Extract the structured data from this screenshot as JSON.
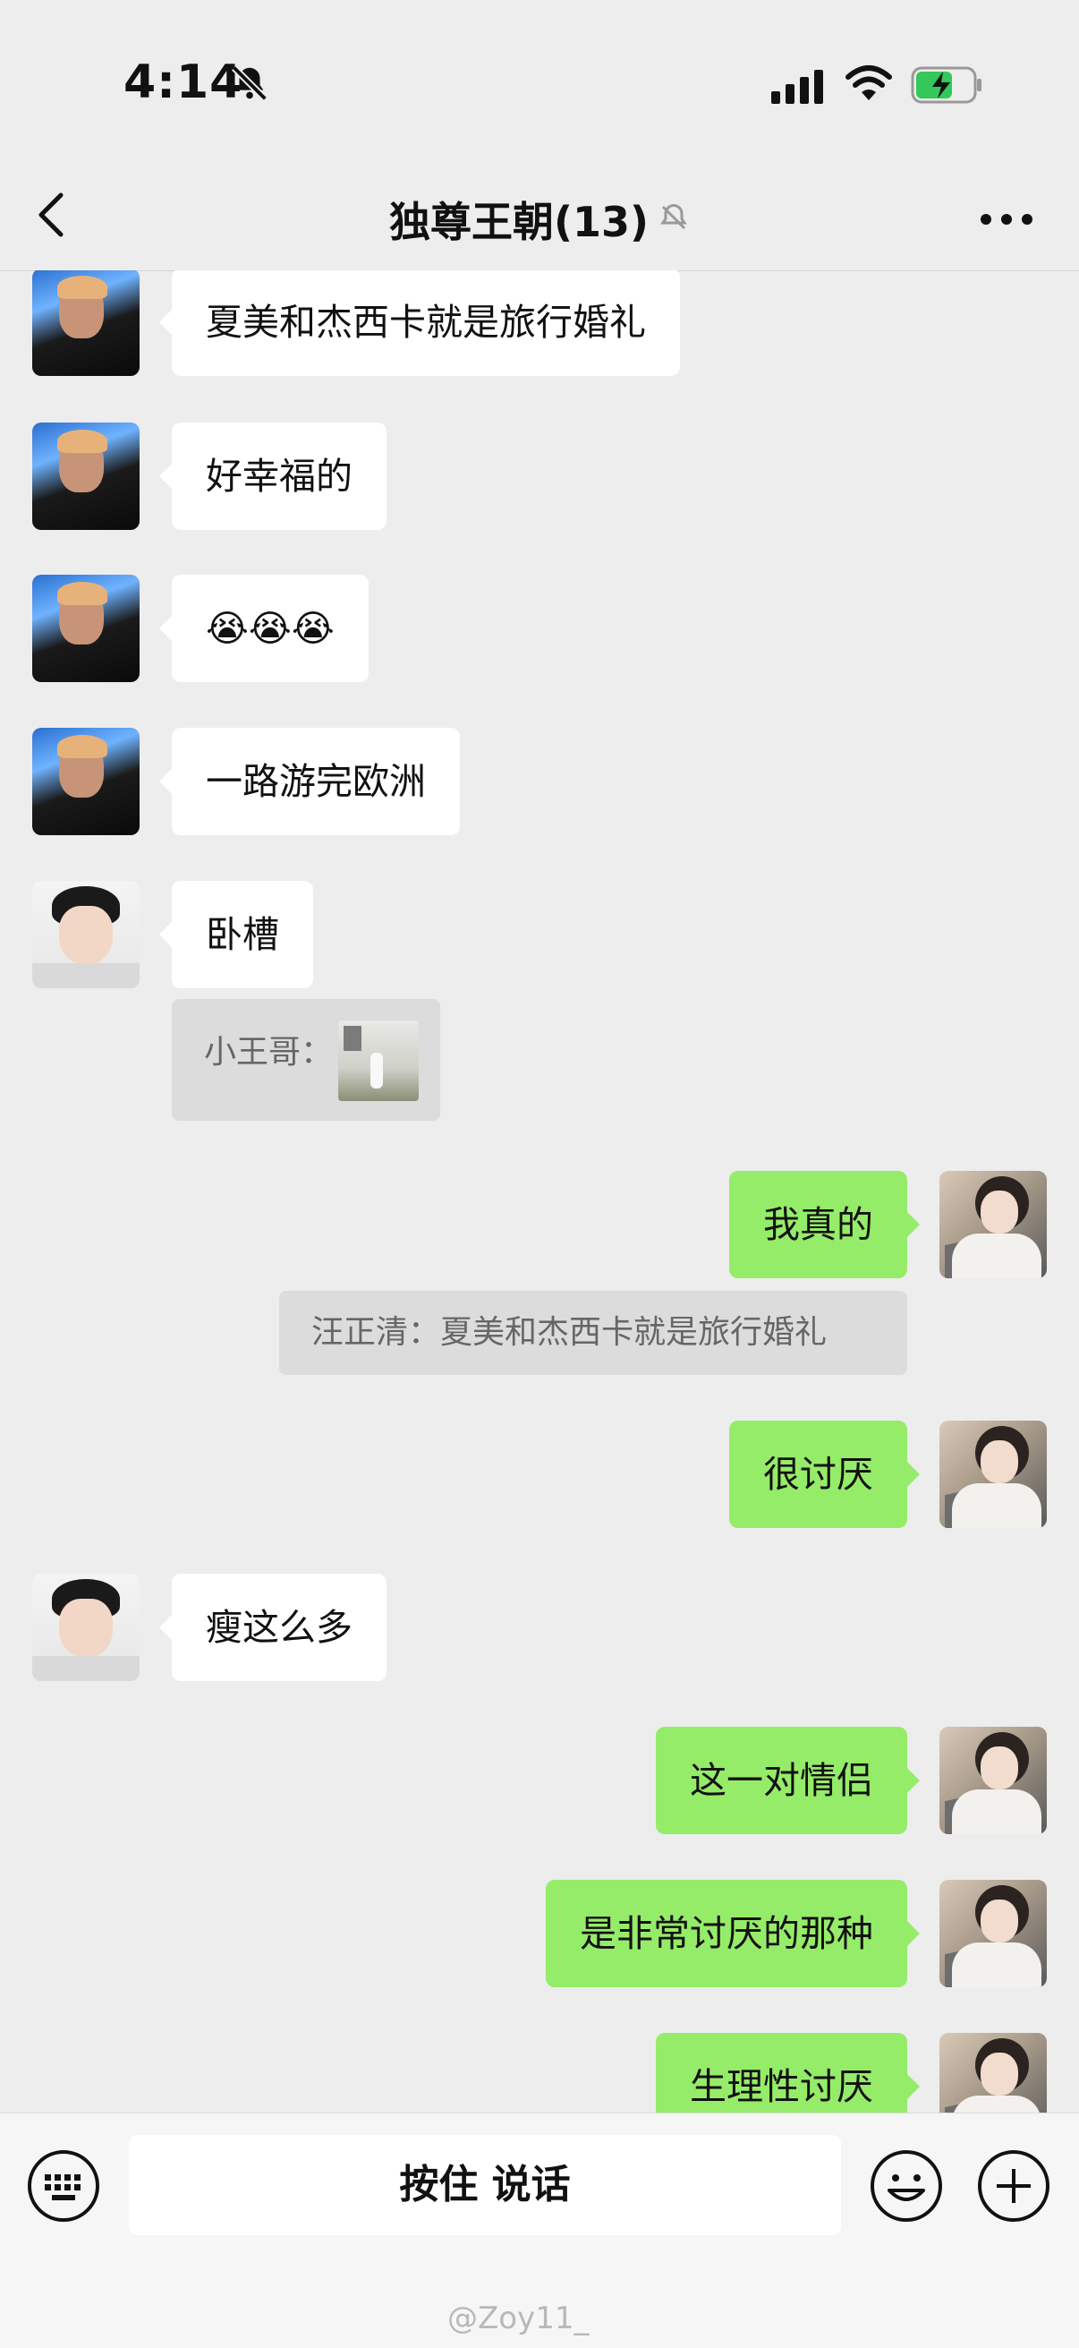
{
  "status_bar": {
    "time": "4:14",
    "icons": [
      "bell-slash-icon",
      "cellular-signal-icon",
      "wifi-icon",
      "battery-charging-icon"
    ]
  },
  "nav": {
    "title": "独尊王朝(13)",
    "muted_icon": "bell-slash-icon",
    "back_icon": "chevron-left-icon",
    "more_icon": "more-dots-icon"
  },
  "messages": [
    {
      "side": "in",
      "sender_avatar": "avatar-a",
      "text": "夏美和杰西卡就是旅行婚礼"
    },
    {
      "side": "in",
      "sender_avatar": "avatar-a",
      "text": "好幸福的"
    },
    {
      "side": "in",
      "sender_avatar": "avatar-a",
      "text": "😭😭😭"
    },
    {
      "side": "in",
      "sender_avatar": "avatar-a",
      "text": "一路游完欧洲"
    },
    {
      "side": "in",
      "sender_avatar": "avatar-b",
      "text": "卧槽",
      "quote": {
        "sender": "小王哥：",
        "type": "image"
      }
    },
    {
      "side": "out",
      "sender_avatar": "avatar-c",
      "text": "我真的",
      "quote": {
        "text": "汪正清：夏美和杰西卡就是旅行婚礼"
      }
    },
    {
      "side": "out",
      "sender_avatar": "avatar-c",
      "text": "很讨厌"
    },
    {
      "side": "in",
      "sender_avatar": "avatar-b",
      "text": "瘦这么多"
    },
    {
      "side": "out",
      "sender_avatar": "avatar-c",
      "text": "这一对情侣"
    },
    {
      "side": "out",
      "sender_avatar": "avatar-c",
      "text": "是非常讨厌的那种"
    },
    {
      "side": "out",
      "sender_avatar": "avatar-c",
      "text": "生理性讨厌"
    }
  ],
  "input_bar": {
    "voice_label": "按住 说话",
    "icons": [
      "keyboard-icon",
      "emoji-icon",
      "plus-icon"
    ]
  },
  "watermark": "@Zoy11_",
  "colors": {
    "background": "#ededed",
    "incoming_bubble": "#ffffff",
    "outgoing_bubble": "#95ec69",
    "quote_bg": "#dcdcdc"
  }
}
